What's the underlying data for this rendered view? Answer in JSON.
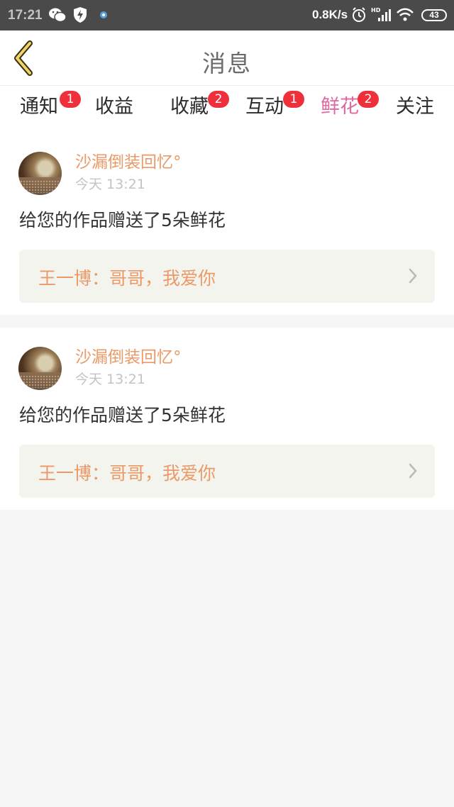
{
  "status_bar": {
    "time": "17:21",
    "net_speed": "0.8K/s",
    "battery": "43",
    "icons": [
      "wechat-icon",
      "shield-bolt-icon",
      "app-icon",
      "alarm-icon",
      "hd-signal-icon",
      "wifi-icon",
      "battery-icon"
    ]
  },
  "header": {
    "back_icon": "chevron-left-icon",
    "title": "消息"
  },
  "tabs": [
    {
      "label": "通知",
      "badge": "1",
      "active": false
    },
    {
      "label": "收益",
      "badge": "",
      "active": false
    },
    {
      "label": "收藏",
      "badge": "2",
      "active": false
    },
    {
      "label": "互动",
      "badge": "1",
      "active": false
    },
    {
      "label": "鲜花",
      "badge": "2",
      "active": true
    },
    {
      "label": "关注",
      "badge": "",
      "active": false
    }
  ],
  "colors": {
    "accent": "#e266a0",
    "badge": "#ef2f3a",
    "username": "#eb9a67"
  },
  "messages": [
    {
      "username": "沙漏倒装回忆°",
      "time": "今天 13:21",
      "text": "给您的作品赠送了5朵鲜花",
      "quote": "王一博：哥哥，我爱你"
    },
    {
      "username": "沙漏倒装回忆°",
      "time": "今天 13:21",
      "text": "给您的作品赠送了5朵鲜花",
      "quote": "王一博：哥哥，我爱你"
    }
  ]
}
